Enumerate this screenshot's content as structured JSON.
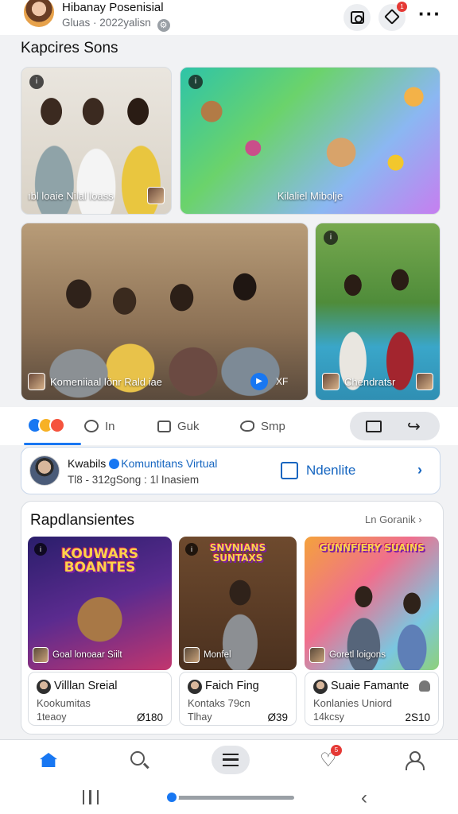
{
  "header": {
    "profile_name": "Hibanay Posenisial",
    "profile_sub": "Gluas · 2022yalisn",
    "notif_badge": "1"
  },
  "section_title": "Kapcires Sons",
  "tiles": {
    "family": "ıbl loaie Nilal loass",
    "toys": "Kilaliel Mibolje",
    "room": "Komeniiaal lönr Rald iae",
    "room_badge": "XF",
    "pool": "Chendratsr"
  },
  "actions": {
    "comment": "In",
    "save": "Guk",
    "send": "Smp"
  },
  "community": {
    "name": "Kwabils",
    "tag": "Komuntitans Virtual",
    "meta": "Tl8 - 312gSong : 1l Inasiem",
    "button": "Ndenlite"
  },
  "recs": {
    "title": "Rapdlansientes",
    "link": "Ln Goranik",
    "items": [
      {
        "poster_title": "KOUWARS BOANTES",
        "poster_caption": "Goal lonoaar Siilt",
        "name": "Villlan Sreial",
        "sub": "Kookumitas",
        "time": "1teaoy",
        "count": "Ø180"
      },
      {
        "poster_title": "SNVNIANS SUNTAXS",
        "poster_caption": "Monfel",
        "name": "Faich Fing",
        "sub": "Kontaks 79cn",
        "time": "Tlhay",
        "count": "Ø39"
      },
      {
        "poster_title": "GUNNFIERY SUAINS",
        "poster_caption": "Goretl loigons",
        "name": "Suaie Famante",
        "sub": "Konlanies Uniord",
        "time": "14kcsy",
        "count": "2S10"
      }
    ]
  },
  "nav": {
    "heart_badge": "5"
  },
  "colors": {
    "accent": "#1877f2",
    "badge": "#e53935",
    "link_blue": "#1565c0"
  }
}
